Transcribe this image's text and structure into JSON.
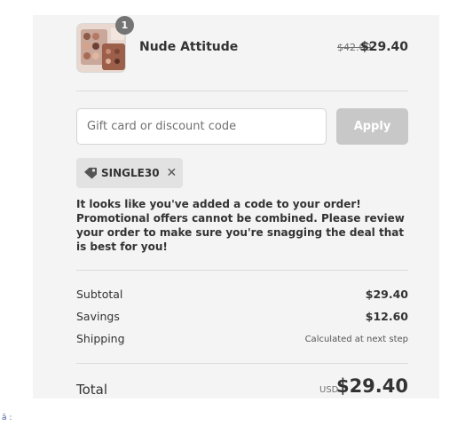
{
  "product": {
    "name": "Nude Attitude",
    "quantity": "1",
    "original_price": "$42.00",
    "price": "$29.40",
    "thumbnail_icon": "eyeshadow-palette-thumbnail"
  },
  "discount": {
    "placeholder": "Gift card or discount code",
    "value": "",
    "apply_label": "Apply",
    "applied_code": "SINGLE30",
    "tag_icon": "tag-icon",
    "remove_icon": "close-icon",
    "message": "It looks like you've added a code to your order! Promotional offers cannot be combined. Please review your order to make sure you're snagging the deal that is best for you!"
  },
  "summary": {
    "subtotal_label": "Subtotal",
    "subtotal_value": "$29.40",
    "savings_label": "Savings",
    "savings_value": "$12.60",
    "shipping_label": "Shipping",
    "shipping_value": "Calculated at next step",
    "total_label": "Total",
    "total_currency": "USD",
    "total_value": "$29.40"
  },
  "stray_text": "ā :",
  "colors": {
    "panel_bg": "#f4f4f4",
    "apply_disabled": "#c8c8c8",
    "tag_bg": "#e2e2e2",
    "badge": "#747474"
  }
}
